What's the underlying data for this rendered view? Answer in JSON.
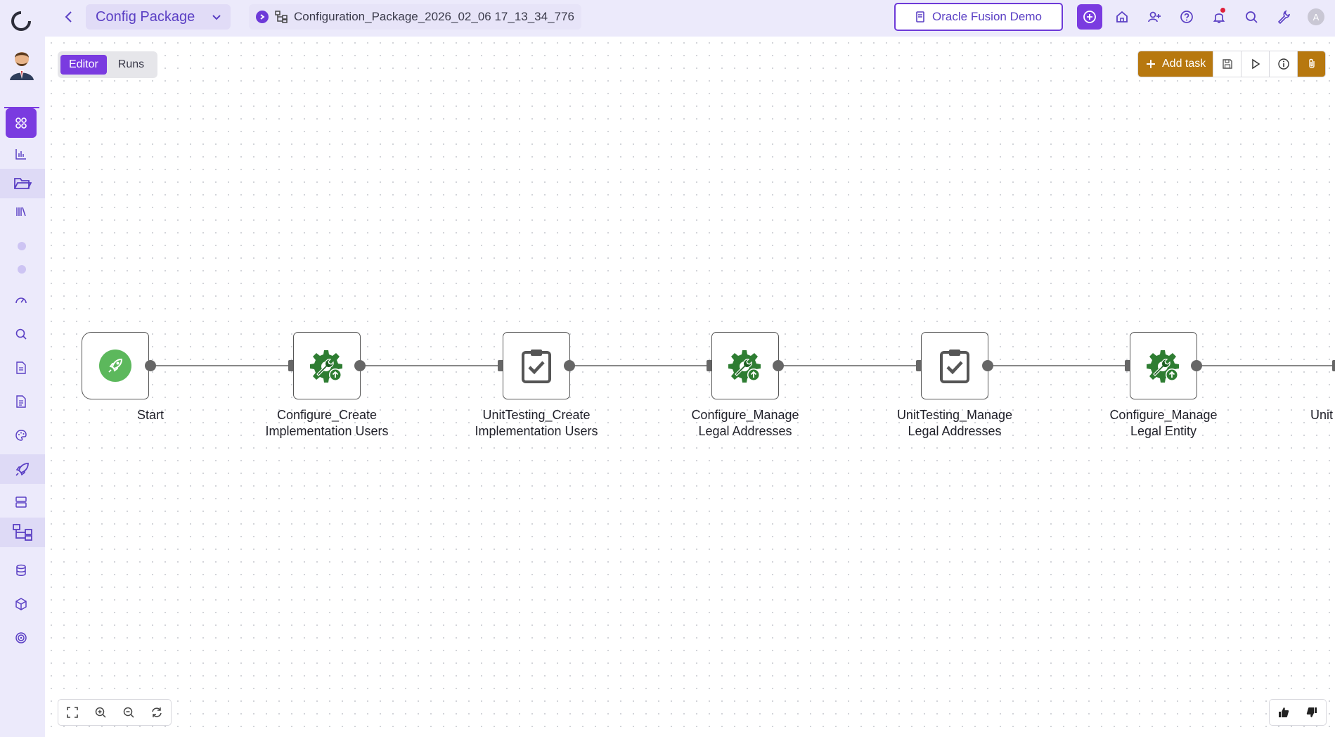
{
  "app": {
    "package_selector": "Config Package",
    "package_name": "Configuration_Package_2026_02_06 17_13_34_776",
    "environment": "Oracle Fusion Demo",
    "user_initial": "A",
    "icons": [
      "add-circle-icon",
      "home-icon",
      "user-add-icon",
      "help-icon",
      "bell-icon",
      "search-icon",
      "wrench-icon"
    ]
  },
  "colors": {
    "accent": "#7a3be0",
    "gold": "#b7780f",
    "task_green": "#2e7d32",
    "start_green": "#5cb85c"
  },
  "sidebar": {
    "items": [
      {
        "name": "modules-icon",
        "active": true
      },
      {
        "name": "chart-icon"
      },
      {
        "name": "folder-icon",
        "highlight": true
      },
      {
        "name": "library-icon"
      },
      {
        "name": "dashboard-gauge-icon"
      },
      {
        "name": "search-icon"
      },
      {
        "name": "document-icon"
      },
      {
        "name": "document-list-icon"
      },
      {
        "name": "palette-icon"
      },
      {
        "name": "rocket-icon",
        "highlight": true
      },
      {
        "name": "server-icon"
      },
      {
        "name": "hierarchy-icon",
        "highlight": true
      },
      {
        "name": "database-icon"
      },
      {
        "name": "box-icon"
      },
      {
        "name": "target-icon"
      }
    ]
  },
  "editor": {
    "modes": [
      "Editor",
      "Runs"
    ],
    "active_mode": "Editor",
    "add_task_label": "Add task"
  },
  "flow": {
    "nodes": [
      {
        "id": "start",
        "type": "start",
        "label_lines": [
          "Start"
        ]
      },
      {
        "id": "n1",
        "type": "configure",
        "label_lines": [
          "Configure_Create",
          "Implementation Users"
        ]
      },
      {
        "id": "n2",
        "type": "unittest",
        "label_lines": [
          "UnitTesting_Create",
          "Implementation Users"
        ]
      },
      {
        "id": "n3",
        "type": "configure",
        "label_lines": [
          "Configure_Manage",
          "Legal Addresses"
        ]
      },
      {
        "id": "n4",
        "type": "unittest",
        "label_lines": [
          "UnitTesting_Manage",
          "Legal Addresses"
        ]
      },
      {
        "id": "n5",
        "type": "configure",
        "label_lines": [
          "Configure_Manage",
          "Legal Entity"
        ]
      },
      {
        "id": "n6",
        "type": "unittest",
        "label_lines": [
          "Unit"
        ]
      }
    ]
  }
}
